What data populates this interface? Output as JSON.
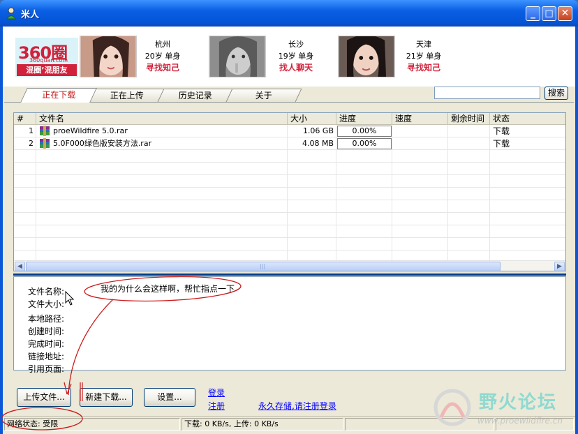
{
  "window": {
    "title": "米人"
  },
  "banner": {
    "logo": {
      "number": "360圈",
      "url": "360quan.com",
      "slogan": "混圈’混朋友"
    },
    "profiles": [
      {
        "city": "杭州",
        "age_status": "20岁  单身",
        "action": "寻找知己"
      },
      {
        "city": "长沙",
        "age_status": "19岁  单身",
        "action": "找人聊天"
      },
      {
        "city": "天津",
        "age_status": "21岁  单身",
        "action": "寻找知己"
      }
    ]
  },
  "tabs": [
    {
      "label": "正在下载",
      "active": true
    },
    {
      "label": "正在上传",
      "active": false
    },
    {
      "label": "历史记录",
      "active": false
    },
    {
      "label": "关于",
      "active": false
    }
  ],
  "search": {
    "value": "",
    "button_label": "搜索"
  },
  "table": {
    "columns": [
      "#",
      "文件名",
      "大小",
      "进度",
      "速度",
      "剩余时间",
      "状态"
    ],
    "rows": [
      {
        "index": "1",
        "name": "proeWildfire 5.0.rar",
        "size": "1.06 GB",
        "progress": "0.00%",
        "speed": "",
        "remaining": "",
        "status": "下载"
      },
      {
        "index": "2",
        "name": "5.0F000绿色版安装方法.rar",
        "size": "4.08 MB",
        "progress": "0.00%",
        "speed": "",
        "remaining": "",
        "status": "下载"
      }
    ]
  },
  "details": {
    "labels": [
      "文件名称:",
      "文件大小:",
      "本地路径:",
      "创建时间:",
      "完成时间:",
      "链接地址:",
      "引用页面:"
    ]
  },
  "annotation": {
    "text": "我的为什么会这样啊，帮忙指点一下"
  },
  "buttons": {
    "upload": "上传文件...",
    "new_download": "新建下载...",
    "settings": "设置..."
  },
  "links": {
    "login": "登录",
    "register": "注册",
    "permanent_storage": "永久存储,请注册登录"
  },
  "statusbar": {
    "network": "网络状态: 受限",
    "transfer": "下载: 0 KB/s, 上传: 0 KB/s"
  },
  "watermark": {
    "title": "野火论坛",
    "url": "www.proewildfire.cn"
  },
  "colors": {
    "titlebar": "#0a5fe4",
    "brand_red": "#d2213a",
    "link": "#0000ff",
    "annotation_red": "#cc1a1a"
  }
}
